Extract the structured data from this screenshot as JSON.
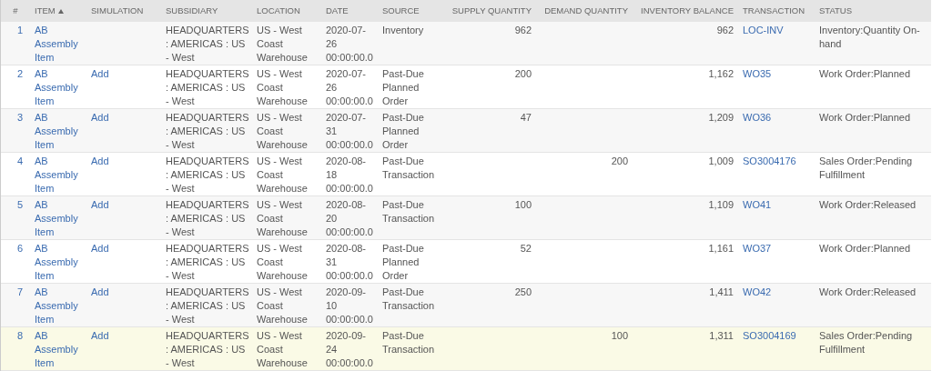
{
  "table": {
    "columns": [
      {
        "label": "#",
        "sorted": false
      },
      {
        "label": "ITEM",
        "sorted": true
      },
      {
        "label": "SIMULATION",
        "sorted": false
      },
      {
        "label": "SUBSIDIARY",
        "sorted": false
      },
      {
        "label": "LOCATION",
        "sorted": false
      },
      {
        "label": "DATE",
        "sorted": false
      },
      {
        "label": "SOURCE",
        "sorted": false
      },
      {
        "label": "SUPPLY QUANTITY",
        "sorted": false
      },
      {
        "label": "DEMAND QUANTITY",
        "sorted": false
      },
      {
        "label": "INVENTORY BALANCE",
        "sorted": false
      },
      {
        "label": "TRANSACTION",
        "sorted": false
      },
      {
        "label": "STATUS",
        "sorted": false
      }
    ],
    "rows": [
      {
        "selected": false,
        "number": "1",
        "item": "AB Assembly Item",
        "simulation": "",
        "subsidiary": "HEADQUARTERS : AMERICAS : US - West",
        "location": "US - West Coast Warehouse",
        "date": "2020-07-26 00:00:00.0",
        "source": "Inventory",
        "supply": "962",
        "demand": "",
        "balance": "962",
        "transaction": "LOC-INV",
        "status": "Inventory:Quantity On-hand"
      },
      {
        "selected": false,
        "number": "2",
        "item": "AB Assembly Item",
        "simulation": "Add",
        "subsidiary": "HEADQUARTERS : AMERICAS : US - West",
        "location": "US - West Coast Warehouse",
        "date": "2020-07-26 00:00:00.0",
        "source": "Past-Due Planned Order",
        "supply": "200",
        "demand": "",
        "balance": "1,162",
        "transaction": "WO35",
        "status": "Work Order:Planned"
      },
      {
        "selected": false,
        "number": "3",
        "item": "AB Assembly Item",
        "simulation": "Add",
        "subsidiary": "HEADQUARTERS : AMERICAS : US - West",
        "location": "US - West Coast Warehouse",
        "date": "2020-07-31 00:00:00.0",
        "source": "Past-Due Planned Order",
        "supply": "47",
        "demand": "",
        "balance": "1,209",
        "transaction": "WO36",
        "status": "Work Order:Planned"
      },
      {
        "selected": false,
        "number": "4",
        "item": "AB Assembly Item",
        "simulation": "Add",
        "subsidiary": "HEADQUARTERS : AMERICAS : US - West",
        "location": "US - West Coast Warehouse",
        "date": "2020-08-18 00:00:00.0",
        "source": "Past-Due Transaction",
        "supply": "",
        "demand": "200",
        "balance": "1,009",
        "transaction": "SO3004176",
        "status": "Sales Order:Pending Fulfillment"
      },
      {
        "selected": false,
        "number": "5",
        "item": "AB Assembly Item",
        "simulation": "Add",
        "subsidiary": "HEADQUARTERS : AMERICAS : US - West",
        "location": "US - West Coast Warehouse",
        "date": "2020-08-20 00:00:00.0",
        "source": "Past-Due Transaction",
        "supply": "100",
        "demand": "",
        "balance": "1,109",
        "transaction": "WO41",
        "status": "Work Order:Released"
      },
      {
        "selected": false,
        "number": "6",
        "item": "AB Assembly Item",
        "simulation": "Add",
        "subsidiary": "HEADQUARTERS : AMERICAS : US - West",
        "location": "US - West Coast Warehouse",
        "date": "2020-08-31 00:00:00.0",
        "source": "Past-Due Planned Order",
        "supply": "52",
        "demand": "",
        "balance": "1,161",
        "transaction": "WO37",
        "status": "Work Order:Planned"
      },
      {
        "selected": false,
        "number": "7",
        "item": "AB Assembly Item",
        "simulation": "Add",
        "subsidiary": "HEADQUARTERS : AMERICAS : US - West",
        "location": "US - West Coast Warehouse",
        "date": "2020-09-10 00:00:00.0",
        "source": "Past-Due Transaction",
        "supply": "250",
        "demand": "",
        "balance": "1,411",
        "transaction": "WO42",
        "status": "Work Order:Released"
      },
      {
        "selected": true,
        "number": "8",
        "item": "AB Assembly Item",
        "simulation": "Add",
        "subsidiary": "HEADQUARTERS : AMERICAS : US - West",
        "location": "US - West Coast Warehouse",
        "date": "2020-09-24 00:00:00.0",
        "source": "Past-Due Transaction",
        "supply": "",
        "demand": "100",
        "balance": "1,311",
        "transaction": "SO3004169",
        "status": "Sales Order:Pending Fulfillment"
      }
    ]
  }
}
